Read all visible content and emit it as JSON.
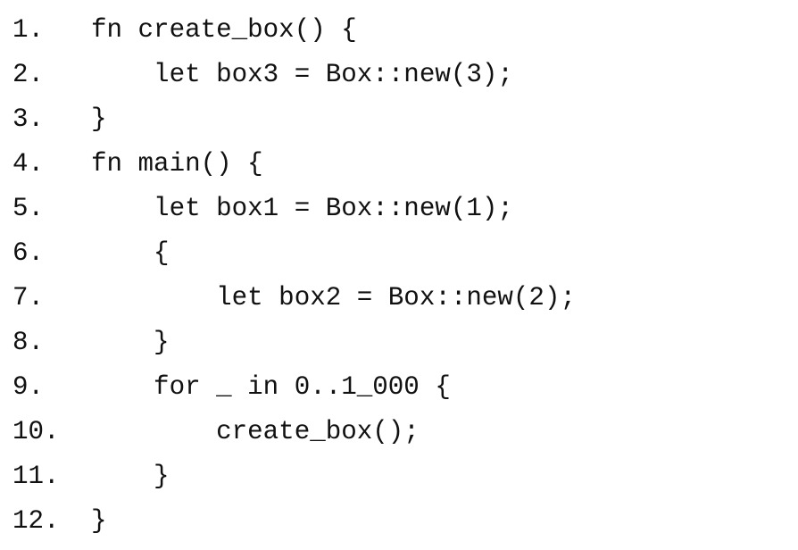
{
  "code": {
    "lines": [
      {
        "number": "1.",
        "text": "fn create_box() {"
      },
      {
        "number": "2.",
        "text": "    let box3 = Box::new(3);"
      },
      {
        "number": "3.",
        "text": "}"
      },
      {
        "number": "4.",
        "text": "fn main() {"
      },
      {
        "number": "5.",
        "text": "    let box1 = Box::new(1);"
      },
      {
        "number": "6.",
        "text": "    {"
      },
      {
        "number": "7.",
        "text": "        let box2 = Box::new(2);"
      },
      {
        "number": "8.",
        "text": "    }"
      },
      {
        "number": "9.",
        "text": "    for _ in 0..1_000 {"
      },
      {
        "number": "10.",
        "text": "        create_box();"
      },
      {
        "number": "11.",
        "text": "    }"
      },
      {
        "number": "12.",
        "text": "}"
      }
    ]
  }
}
